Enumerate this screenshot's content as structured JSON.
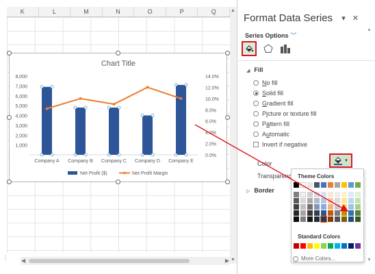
{
  "sheet": {
    "columns": [
      "K",
      "L",
      "M",
      "N",
      "O",
      "P",
      "Q"
    ]
  },
  "chart": {
    "title": "Chart Title",
    "legend": [
      "Net Profit ($)",
      "Net Profit Margin"
    ]
  },
  "chart_data": {
    "type": "bar",
    "title": "Chart Title",
    "categories": [
      "Company A",
      "Company B",
      "Company C",
      "Company D",
      "Company E"
    ],
    "ylim": [
      0,
      8000
    ],
    "y2lim": [
      0,
      0.14
    ],
    "yticks": [
      "8,000",
      "7,000",
      "6,000",
      "5,000",
      "4,000",
      "3,000",
      "2,000",
      "1,000"
    ],
    "y2ticks": [
      "14.0%",
      "12.0%",
      "10.0%",
      "8.0%",
      "6.0%",
      "4.0%",
      "2.0%",
      "0.0%"
    ],
    "series": [
      {
        "name": "Net Profit ($)",
        "type": "bar",
        "axis": "primary",
        "color": "#2e5597",
        "values": [
          6900,
          4800,
          4800,
          4000,
          7100
        ]
      },
      {
        "name": "Net Profit Margin",
        "type": "line",
        "axis": "secondary",
        "color": "#ed7d31",
        "values": [
          0.082,
          0.1,
          0.09,
          0.12,
          0.1
        ]
      }
    ],
    "legend_position": "bottom",
    "grid": false
  },
  "pane": {
    "title": "Format Data Series",
    "series_options": "Series Options",
    "fill_section": "Fill",
    "border_section": "Border",
    "fill_options": [
      "No fill",
      "Solid fill",
      "Gradient fill",
      "Picture or texture fill",
      "Pattern fill",
      "Automatic"
    ],
    "fill_selected": "Solid fill",
    "invert_label": "Invert if negative",
    "color_label": "Color",
    "transparency_label": "Transparency"
  },
  "palette": {
    "theme_heading": "Theme Colors",
    "standard_heading": "Standard Colors",
    "more_colors": "More Colors...",
    "theme_base": [
      "#000000",
      "#ffffff",
      "#e7e6e6",
      "#44546a",
      "#4472c4",
      "#ed7d31",
      "#a5a5a5",
      "#ffc000",
      "#5b9bd5",
      "#70ad47"
    ],
    "theme_shades": [
      [
        "#7f7f7f",
        "#f2f2f2",
        "#d0cece",
        "#d6dce4",
        "#d9e2f3",
        "#fbe5d5",
        "#ededed",
        "#fff2cc",
        "#deebf6",
        "#e2efd9"
      ],
      [
        "#595959",
        "#d8d8d8",
        "#aeaaaa",
        "#adb9ca",
        "#b4c6e7",
        "#f7cbac",
        "#dbdbdb",
        "#fee599",
        "#bdd7ee",
        "#c5e0b3"
      ],
      [
        "#3f3f3f",
        "#bfbfbf",
        "#757070",
        "#8496b0",
        "#8eaadb",
        "#f4b183",
        "#c9c9c9",
        "#ffd965",
        "#9cc3e5",
        "#a8d08d"
      ],
      [
        "#262626",
        "#a5a5a5",
        "#3a3838",
        "#323f4f",
        "#2f5496",
        "#c55a11",
        "#7b7b7b",
        "#bf9000",
        "#2e75b5",
        "#538135"
      ],
      [
        "#0c0c0c",
        "#7f7f7f",
        "#171616",
        "#222a35",
        "#1f3864",
        "#833c0b",
        "#525252",
        "#7f6000",
        "#1e4e79",
        "#375623"
      ]
    ],
    "standard": [
      "#c00000",
      "#ff0000",
      "#ffc000",
      "#ffff00",
      "#92d050",
      "#00b050",
      "#00b0f0",
      "#0070c0",
      "#002060",
      "#7030a0"
    ],
    "selected_swatch": "#1f3864"
  },
  "colors": {
    "accent_red": "#d4191f",
    "bar_blue": "#2e5597",
    "line_orange": "#ed7d31"
  }
}
